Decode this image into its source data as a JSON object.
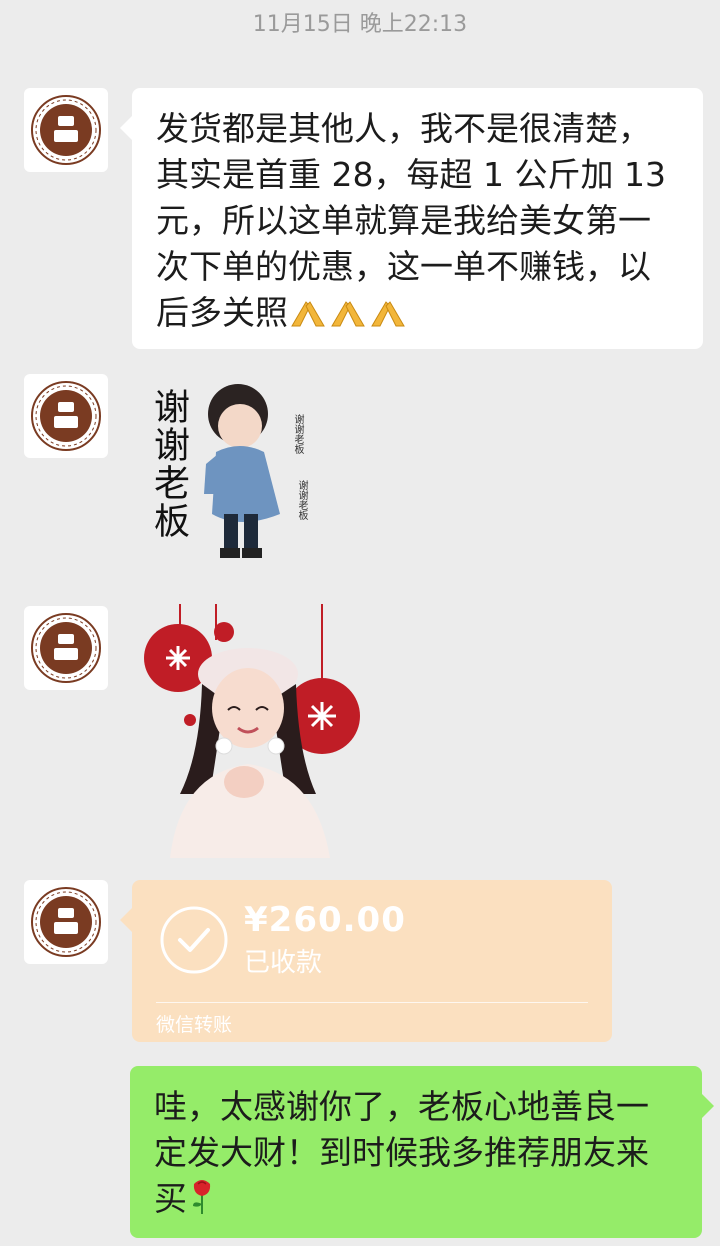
{
  "timestamp": "11月15日 晚上22:13",
  "messages": {
    "m1": {
      "line1": "发货都是其他人，我不是很清楚，",
      "line2": "其实是首重 28，每超 1 公斤加 13",
      "line3": "元，所以这单就算是我给美女第一",
      "line4": "次下单的优惠，这一单不赚钱，以",
      "line5": "后多关照",
      "emoji": "pray-hands-icon ×3"
    },
    "sticker1": {
      "caption": "谢谢老板",
      "small_text": "谢谢老板"
    },
    "sticker2": {
      "description_icon": "christmas-ornament-girl-sticker"
    },
    "transfer": {
      "amount": "¥260.00",
      "status": "已收款",
      "label": "微信转账"
    },
    "reply": {
      "line1": "哇，太感谢你了，老板心地善良一",
      "line2": "定发大财！到时候我多推荐朋友来",
      "line3": "买",
      "emoji": "rose-icon"
    }
  },
  "colors": {
    "background": "#ececec",
    "incoming_bubble": "#ffffff",
    "outgoing_bubble": "#95ec69",
    "transfer_card": "#fbe0c0",
    "timestamp_text": "#9a9a9a",
    "avatar_brown": "#7a3b22"
  }
}
